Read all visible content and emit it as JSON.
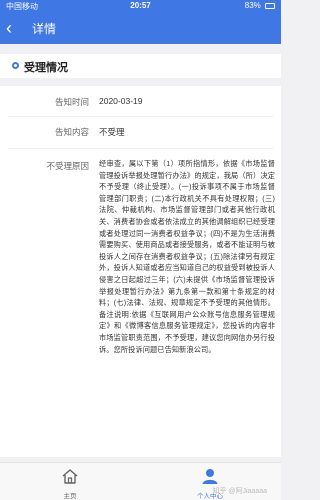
{
  "status_bar": {
    "carrier": "中国移动",
    "time": "20:57",
    "battery": "83%"
  },
  "nav": {
    "back_icon": "chevron-left-icon",
    "title": "详情"
  },
  "section": {
    "title": "受理情况"
  },
  "details": {
    "notify_time_label": "告知时间",
    "notify_time_value": "2020-03-19",
    "notify_content_label": "告知内容",
    "notify_content_value": "不受理",
    "reason_label": "不受理原因",
    "reason_value": "经审查，属以下第（1）项所指情形，依据《市场监督管理投诉举报处理暂行办法》的规定，我局（所）决定不予受理（终止受理）。(一)投诉事项不属于市场监督管理部门职责；(二)本行政机关不具有处理权限；(三)法院、仲裁机构、市场监督管理部门或者其他行政机关、消费者协会或者依法成立的其他调解组织已经受理或者处理过同一消费者权益争议；(四)不是为生活消费需要购买、使用商品或者接受服务，或者不能证明与被投诉人之间存在消费者权益争议；(五)除法律另有规定外，投诉人知道或者应当知道自己的权益受到被投诉人侵害之日起超过三年；(六)未提供《市场监督管理投诉举报处理暂行办法》第九条第一款和第十条规定的材料；(七)法律、法规、规章规定不予受理的其他情形。备注说明:依据《互联网用户公众账号信息服务管理规定》和《微博客信息服务管理规定》，您投诉的内容非市场监管职责范围，不予受理，建议您向网信办另行投诉。您所投诉问题已告知新浪公司。"
  },
  "tab_bar": {
    "home_label": "主页",
    "home_icon": "home-icon",
    "profile_label": "个人中心",
    "profile_icon": "user-icon"
  },
  "watermark": "知乎 @阿Jiaaaaa",
  "colors": {
    "accent": "#3f77e4"
  }
}
